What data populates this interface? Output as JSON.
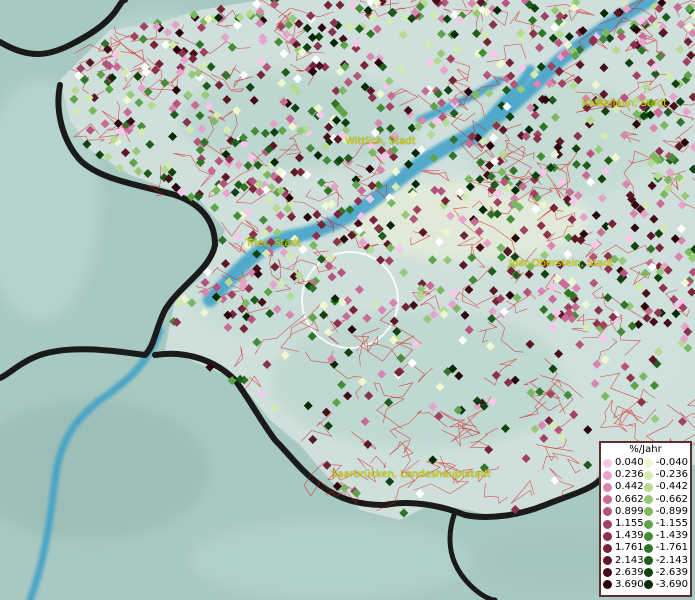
{
  "map": {
    "cities": [
      {
        "name": "Wittlich, Stadt"
      },
      {
        "name": "Kastellaun, Stadt"
      },
      {
        "name": "Trier, Stadt"
      },
      {
        "name": "Idar-Oberstein, Stadt"
      },
      {
        "name": "Saarbrücken, Landeshauptstadt"
      }
    ]
  },
  "legend": {
    "title": "%/Jahr",
    "positive": [
      {
        "value": "0.040",
        "color": "#f7c6ea"
      },
      {
        "value": "0.236",
        "color": "#e6a3cb"
      },
      {
        "value": "0.442",
        "color": "#d786b0"
      },
      {
        "value": "0.662",
        "color": "#c86b95"
      },
      {
        "value": "0.899",
        "color": "#b6547c"
      },
      {
        "value": "1.155",
        "color": "#a24263"
      },
      {
        "value": "1.439",
        "color": "#8c324c"
      },
      {
        "value": "1.761",
        "color": "#762438"
      },
      {
        "value": "2.143",
        "color": "#5c1826"
      },
      {
        "value": "2.639",
        "color": "#440d18"
      },
      {
        "value": "3.690",
        "color": "#2a050b"
      }
    ],
    "negative": [
      {
        "value": "-0.040",
        "color": "#eef7d0"
      },
      {
        "value": "-0.236",
        "color": "#d3eab0"
      },
      {
        "value": "-0.442",
        "color": "#b5da92"
      },
      {
        "value": "-0.662",
        "color": "#98c979"
      },
      {
        "value": "-0.899",
        "color": "#7cb862"
      },
      {
        "value": "-1.155",
        "color": "#5ea34a"
      },
      {
        "value": "-1.439",
        "color": "#468c38"
      },
      {
        "value": "-1.761",
        "color": "#317428"
      },
      {
        "value": "-2.143",
        "color": "#1f5c1b"
      },
      {
        "value": "-2.639",
        "color": "#114210"
      },
      {
        "value": "-3.690",
        "color": "#062a07"
      }
    ]
  }
}
